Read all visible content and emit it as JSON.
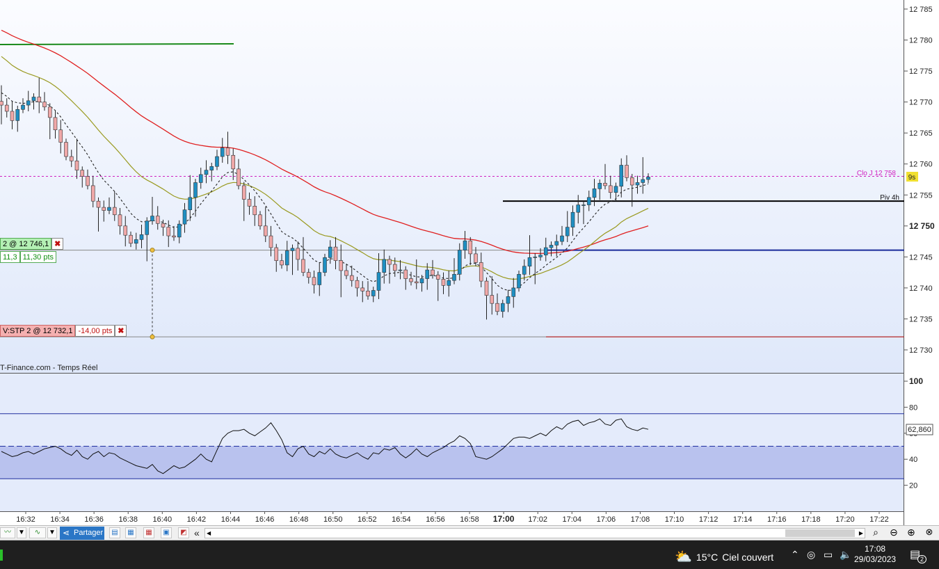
{
  "chart_data": [
    {
      "type": "candlestick",
      "ylim": [
        12728,
        12786
      ],
      "y_ticks": [
        12730,
        12735,
        12740,
        12745,
        12750,
        12755,
        12760,
        12765,
        12770,
        12775,
        12780,
        12785
      ],
      "y_tick_labels": [
        "12 730",
        "12 735",
        "12 740",
        "12 745",
        "12 750",
        "12 755",
        "12 760",
        "12 765",
        "12 770",
        "12 775",
        "12 780",
        "12 785"
      ],
      "y_bold_tick": "12 750",
      "x_ticks": [
        "16:32",
        "16:34",
        "16:36",
        "16:38",
        "16:40",
        "16:42",
        "16:44",
        "16:46",
        "16:48",
        "16:50",
        "16:52",
        "16:54",
        "16:56",
        "16:58",
        "17:00",
        "17:02",
        "17:04",
        "17:06",
        "17:08",
        "17:10",
        "17:12",
        "17:14",
        "17:16",
        "17:18",
        "17:20",
        "17:22"
      ],
      "x_bold_tick": "17:00",
      "up_color": "#1f8fc2",
      "down_color": "#f0a8a8",
      "closes": [
        12769.5,
        12768.5,
        12767.0,
        12768.8,
        12769.5,
        12770.2,
        12770.8,
        12770.0,
        12769.2,
        12767.5,
        12765.5,
        12763.5,
        12761.2,
        12760.5,
        12759.0,
        12758.0,
        12756.5,
        12754.0,
        12753.0,
        12752.5,
        12753.0,
        12751.8,
        12750.0,
        12748.5,
        12747.2,
        12747.8,
        12748.6,
        12750.8,
        12751.6,
        12750.4,
        12749.8,
        12748.4,
        12748.2,
        12750.3,
        12752.6,
        12754.6,
        12757.0,
        12758.3,
        12759.0,
        12759.6,
        12761.2,
        12762.6,
        12761.4,
        12759.2,
        12756.5,
        12754.3,
        12753.2,
        12751.8,
        12750.0,
        12748.4,
        12746.5,
        12744.4,
        12743.7,
        12746.0,
        12746.4,
        12744.6,
        12742.5,
        12741.7,
        12740.5,
        12742.5,
        12744.9,
        12746.6,
        12744.4,
        12742.8,
        12742.0,
        12741.2,
        12740.0,
        12739.5,
        12738.7,
        12739.6,
        12742.5,
        12744.6,
        12743.8,
        12742.8,
        12742.9,
        12741.5,
        12741.0,
        12740.8,
        12741.5,
        12742.9,
        12742.1,
        12741.4,
        12740.4,
        12741.2,
        12742.2,
        12746.1,
        12747.6,
        12745.5,
        12744.1,
        12741.1,
        12738.8,
        12737.5,
        12736.2,
        12737.5,
        12738.6,
        12740.0,
        12742.2,
        12743.5,
        12744.9,
        12745.0,
        12745.3,
        12746.5,
        12746.9,
        12747.5,
        12748.4,
        12749.8,
        12752.2,
        12753.4,
        12753.4,
        12754.6,
        12756.0,
        12756.9,
        12756.5,
        12755.4,
        12756.4,
        12759.8,
        12757.8,
        12756.6,
        12757.0,
        12757.5,
        12757.9
      ],
      "clo_j_line": 12758,
      "piv_4h_line": 12754,
      "buy_order_line": 12746.1,
      "stop_order_line": 12732.1
    },
    {
      "type": "line",
      "ylim": [
        0,
        110
      ],
      "y_ticks": [
        20,
        40,
        60,
        80,
        100
      ],
      "y_tick_labels": [
        "20",
        "40",
        "60",
        "80",
        "100"
      ],
      "bands": [
        25,
        50,
        75
      ],
      "current_value_label": "62,860",
      "values": [
        46,
        44,
        42,
        43,
        45,
        46,
        44,
        46,
        48,
        49,
        50,
        48,
        45,
        43,
        47,
        42,
        40,
        44,
        46,
        42,
        45,
        44,
        41,
        39,
        37,
        35,
        34,
        33,
        36,
        31,
        29,
        32,
        35,
        33,
        34,
        37,
        40,
        44,
        40,
        38,
        47,
        56,
        60,
        62,
        62,
        63,
        60,
        58,
        61,
        64,
        68,
        62,
        55,
        45,
        42,
        48,
        50,
        44,
        42,
        46,
        44,
        48,
        44,
        42,
        41,
        43,
        45,
        42,
        40,
        45,
        44,
        48,
        47,
        49,
        44,
        41,
        44,
        48,
        44,
        42,
        45,
        47,
        49,
        52,
        54,
        58,
        56,
        52,
        42,
        41,
        40,
        42,
        45,
        48,
        52,
        56,
        57,
        57,
        56,
        58,
        60,
        58,
        62,
        65,
        63,
        67,
        69,
        70,
        66,
        68,
        69,
        71,
        67,
        66,
        70,
        71,
        65,
        63,
        62,
        64,
        63
      ]
    }
  ],
  "annotations": {
    "clo_j": "Clo J 12 758",
    "countdown": "9s",
    "piv_4h": "Piv 4h"
  },
  "orders": {
    "buy": {
      "label": "2 @ 12 746,1",
      "close_icon": "✖",
      "sub1": "11,3",
      "sub2": "11,30 pts"
    },
    "stop": {
      "label": "V:STP 2 @ 12 732,1",
      "pts": "-14,00 pts",
      "close_icon": "✖"
    }
  },
  "source_label": "T-Finance.com - Temps Réel",
  "toolbar": {
    "share_label": "Partager",
    "double_left": "«",
    "left_arrow": "◀",
    "right_arrow": "▶",
    "dropdown_glyph": "▼"
  },
  "taskbar": {
    "temperature": "15°C",
    "weather_desc": "Ciel couvert",
    "time": "17:08",
    "date": "29/03/2023",
    "notif_count": "2"
  }
}
